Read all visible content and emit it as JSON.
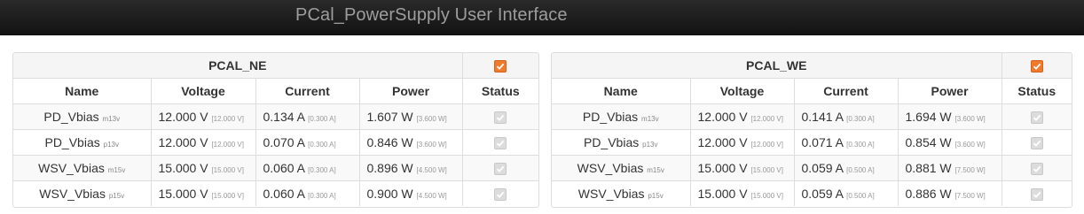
{
  "app": {
    "title": "PCal_PowerSupply User Interface"
  },
  "columns": {
    "name": "Name",
    "voltage": "Voltage",
    "current": "Current",
    "power": "Power",
    "status": "Status"
  },
  "panels": [
    {
      "title": "PCAL_NE",
      "enabled": true,
      "rows": [
        {
          "name": "PD_Vbias",
          "sub": "m13v",
          "voltage": "12.000 V",
          "vlim": "[12.000 V]",
          "current": "0.134 A",
          "clim": "[0.300 A]",
          "power": "1.607 W",
          "plim": "[3.600 W]",
          "status": true
        },
        {
          "name": "PD_Vbias",
          "sub": "p13v",
          "voltage": "12.000 V",
          "vlim": "[12.000 V]",
          "current": "0.070 A",
          "clim": "[0.300 A]",
          "power": "0.846 W",
          "plim": "[3.600 W]",
          "status": true
        },
        {
          "name": "WSV_Vbias",
          "sub": "m15v",
          "voltage": "15.000 V",
          "vlim": "[15.000 V]",
          "current": "0.060 A",
          "clim": "[0.300 A]",
          "power": "0.896 W",
          "plim": "[4.500 W]",
          "status": true
        },
        {
          "name": "WSV_Vbias",
          "sub": "p15v",
          "voltage": "15.000 V",
          "vlim": "[15.000 V]",
          "current": "0.060 A",
          "clim": "[0.300 A]",
          "power": "0.900 W",
          "plim": "[4.500 W]",
          "status": true
        }
      ]
    },
    {
      "title": "PCAL_WE",
      "enabled": true,
      "rows": [
        {
          "name": "PD_Vbias",
          "sub": "m13v",
          "voltage": "12.000 V",
          "vlim": "[12.000 V]",
          "current": "0.141 A",
          "clim": "[0.300 A]",
          "power": "1.694 W",
          "plim": "[3.600 W]",
          "status": true
        },
        {
          "name": "PD_Vbias",
          "sub": "p13v",
          "voltage": "12.000 V",
          "vlim": "[12.000 V]",
          "current": "0.071 A",
          "clim": "[0.300 A]",
          "power": "0.854 W",
          "plim": "[3.600 W]",
          "status": true
        },
        {
          "name": "WSV_Vbias",
          "sub": "m15v",
          "voltage": "15.000 V",
          "vlim": "[15.000 V]",
          "current": "0.059 A",
          "clim": "[0.500 A]",
          "power": "0.881 W",
          "plim": "[7.500 W]",
          "status": true
        },
        {
          "name": "WSV_Vbias",
          "sub": "p15v",
          "voltage": "15.000 V",
          "vlim": "[15.000 V]",
          "current": "0.059 A",
          "clim": "[0.500 A]",
          "power": "0.886 W",
          "plim": "[7.500 W]",
          "status": true
        }
      ]
    }
  ]
}
